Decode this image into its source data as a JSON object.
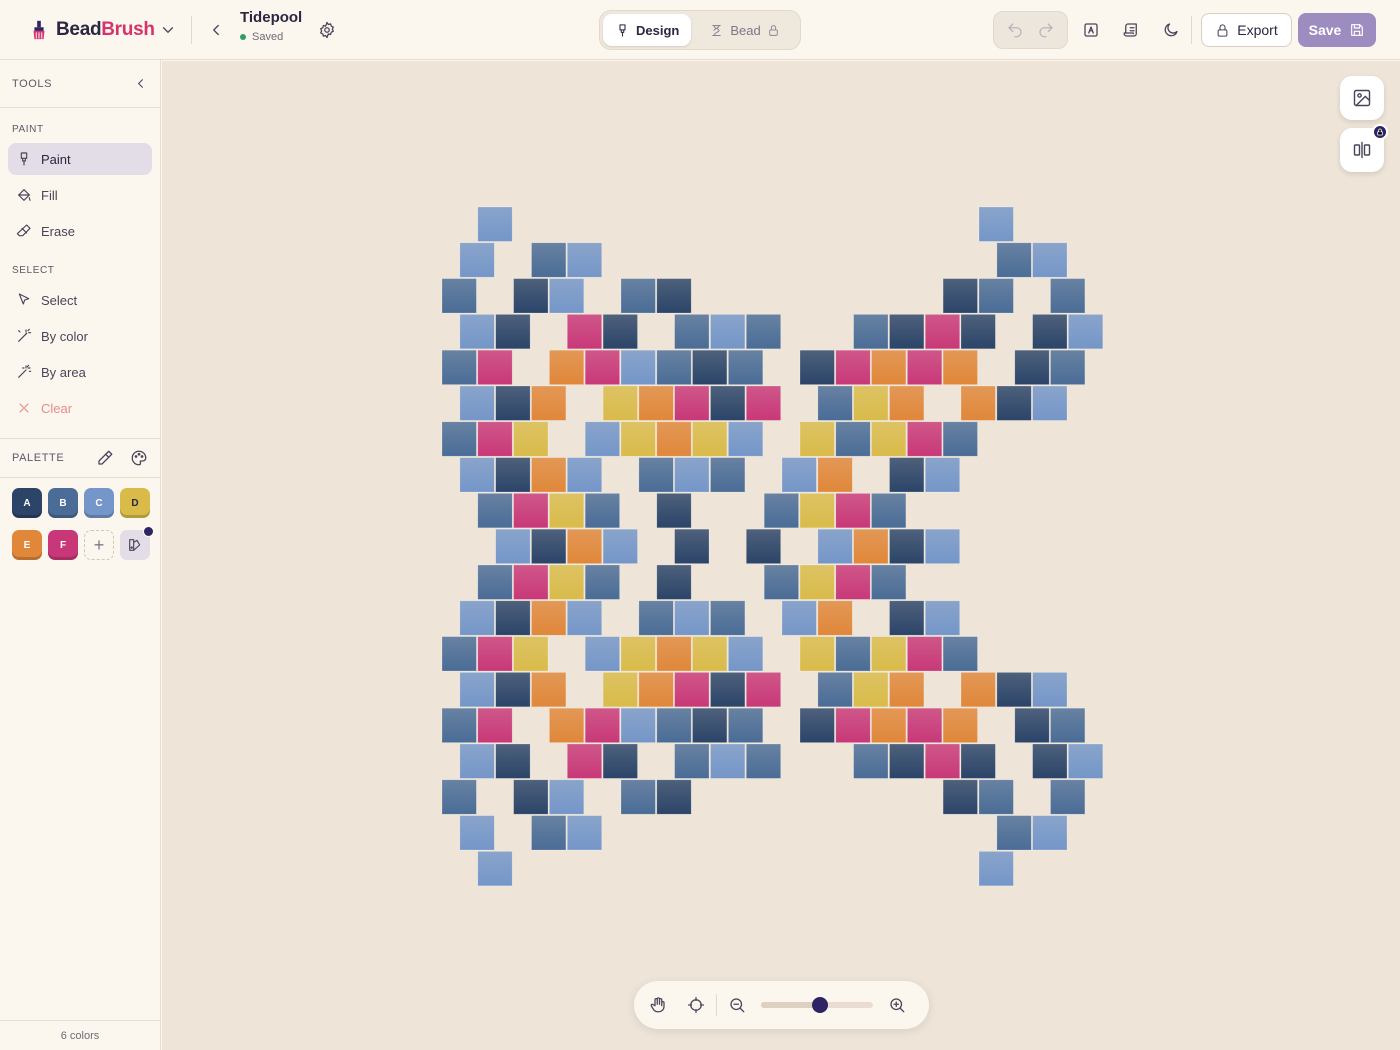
{
  "app": {
    "brand_part1": "Bead",
    "brand_part2": "Brush"
  },
  "document": {
    "title": "Tidepool",
    "status": "Saved"
  },
  "modes": [
    {
      "label": "Design"
    },
    {
      "label": "Bead"
    }
  ],
  "toolbar": {
    "export_label": "Export",
    "save_label": "Save"
  },
  "sidebar": {
    "title": "TOOLS",
    "paint_section": "PAINT",
    "paint_tools": [
      {
        "label": "Paint"
      },
      {
        "label": "Fill"
      },
      {
        "label": "Erase"
      }
    ],
    "select_section": "SELECT",
    "select_tools": [
      {
        "label": "Select"
      },
      {
        "label": "By color"
      },
      {
        "label": "By area"
      },
      {
        "label": "Clear"
      }
    ],
    "palette_title": "PALETTE",
    "footer": "6 colors"
  },
  "palette": [
    {
      "key": "A",
      "color": "#2b4468"
    },
    {
      "key": "B",
      "color": "#4a6c96"
    },
    {
      "key": "C",
      "color": "#7496c8"
    },
    {
      "key": "D",
      "color": "#d9bb4a"
    },
    {
      "key": "E",
      "color": "#e0873a"
    },
    {
      "key": "F",
      "color": "#c83878"
    }
  ],
  "zoom": {
    "level": 0.53
  },
  "pattern": {
    "cols": 19,
    "rows": 19,
    "rows_data": [
      ".C.............C...",
      "C.BC...........BC..",
      "B.AC.BA.......AB.B.",
      "CA.FA.BCB..BAFA.AC.",
      "BF.EFCBAB.AFEFE.AB.",
      "CAE.DEFAF.BDE.EAC..",
      "BFD.CDEDC.DBDFB....",
      "CAEC.BCB.CE.AC.....",
      ".BFDB.A..BDFB......",
      ".CAEC.A.A.CEAC.....",
      ".BFDB.A..BDFB......",
      "CAEC.BCB.CE.AC.....",
      "BFD.CDEDC.DBDFB....",
      "CAE.DEFAF.BDE.EAC..",
      "BF.EFCBAB.AFEFE.AB.",
      "CA.FA.BCB..BAFA.AC.",
      "B.AC.BA.......AB.B.",
      "C.BC...........BC..",
      ".C.............C..."
    ]
  }
}
